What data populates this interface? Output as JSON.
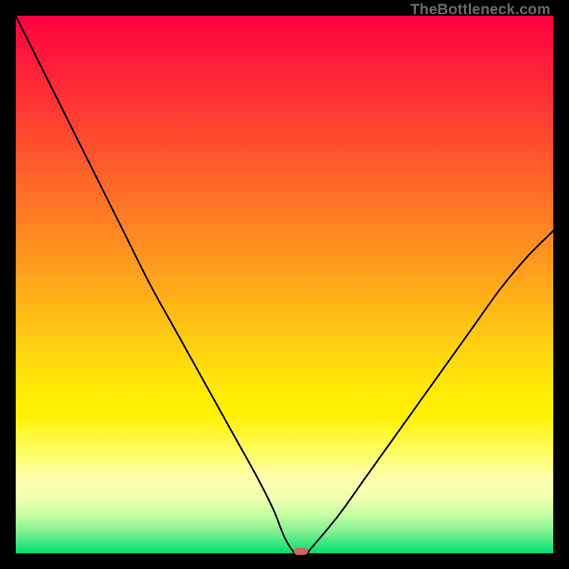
{
  "watermark": "TheBottleneck.com",
  "colors": {
    "gradient_top": "#ff0040",
    "gradient_bottom": "#00e070",
    "curve": "#000000",
    "marker": "#cc6666",
    "frame": "#000000"
  },
  "chart_data": {
    "type": "line",
    "title": "",
    "xlabel": "",
    "ylabel": "",
    "xlim": [
      0,
      100
    ],
    "ylim": [
      0,
      100
    ],
    "x": [
      0,
      5,
      10,
      15,
      20,
      25,
      30,
      35,
      40,
      45,
      48,
      50,
      52,
      54,
      55,
      60,
      65,
      70,
      75,
      80,
      85,
      90,
      95,
      100
    ],
    "values": [
      100,
      90,
      80,
      70,
      60,
      50,
      41,
      32,
      23,
      14,
      8,
      3,
      0,
      0,
      1,
      7,
      14,
      21,
      28,
      35,
      42,
      49,
      55,
      60
    ],
    "minimum_x": 53,
    "minimum_y": 0,
    "annotations": [
      {
        "type": "marker",
        "x": 53,
        "y": 0,
        "shape": "pill",
        "color": "#cc6666"
      }
    ]
  }
}
